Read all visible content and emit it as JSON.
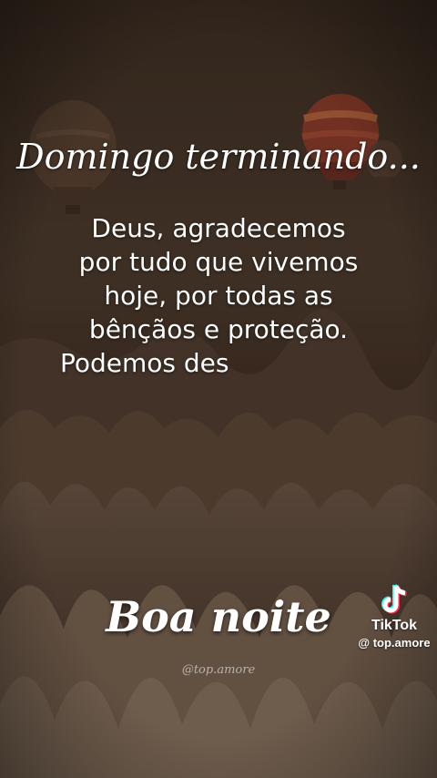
{
  "headline": "Domingo terminando...",
  "body_lines": [
    "Deus, agradecemos",
    "por tudo que vivemos",
    "hoje, por todas as",
    "bênçãos e proteção.",
    "Podemos des"
  ],
  "closing": "Boa noite",
  "watermark_handle": "@top.amore",
  "tiktok": {
    "brand": "TikTok",
    "username": "@ top.amore"
  },
  "icons": [
    "hot-air-balloon-icon",
    "tiktok-logo-icon"
  ]
}
